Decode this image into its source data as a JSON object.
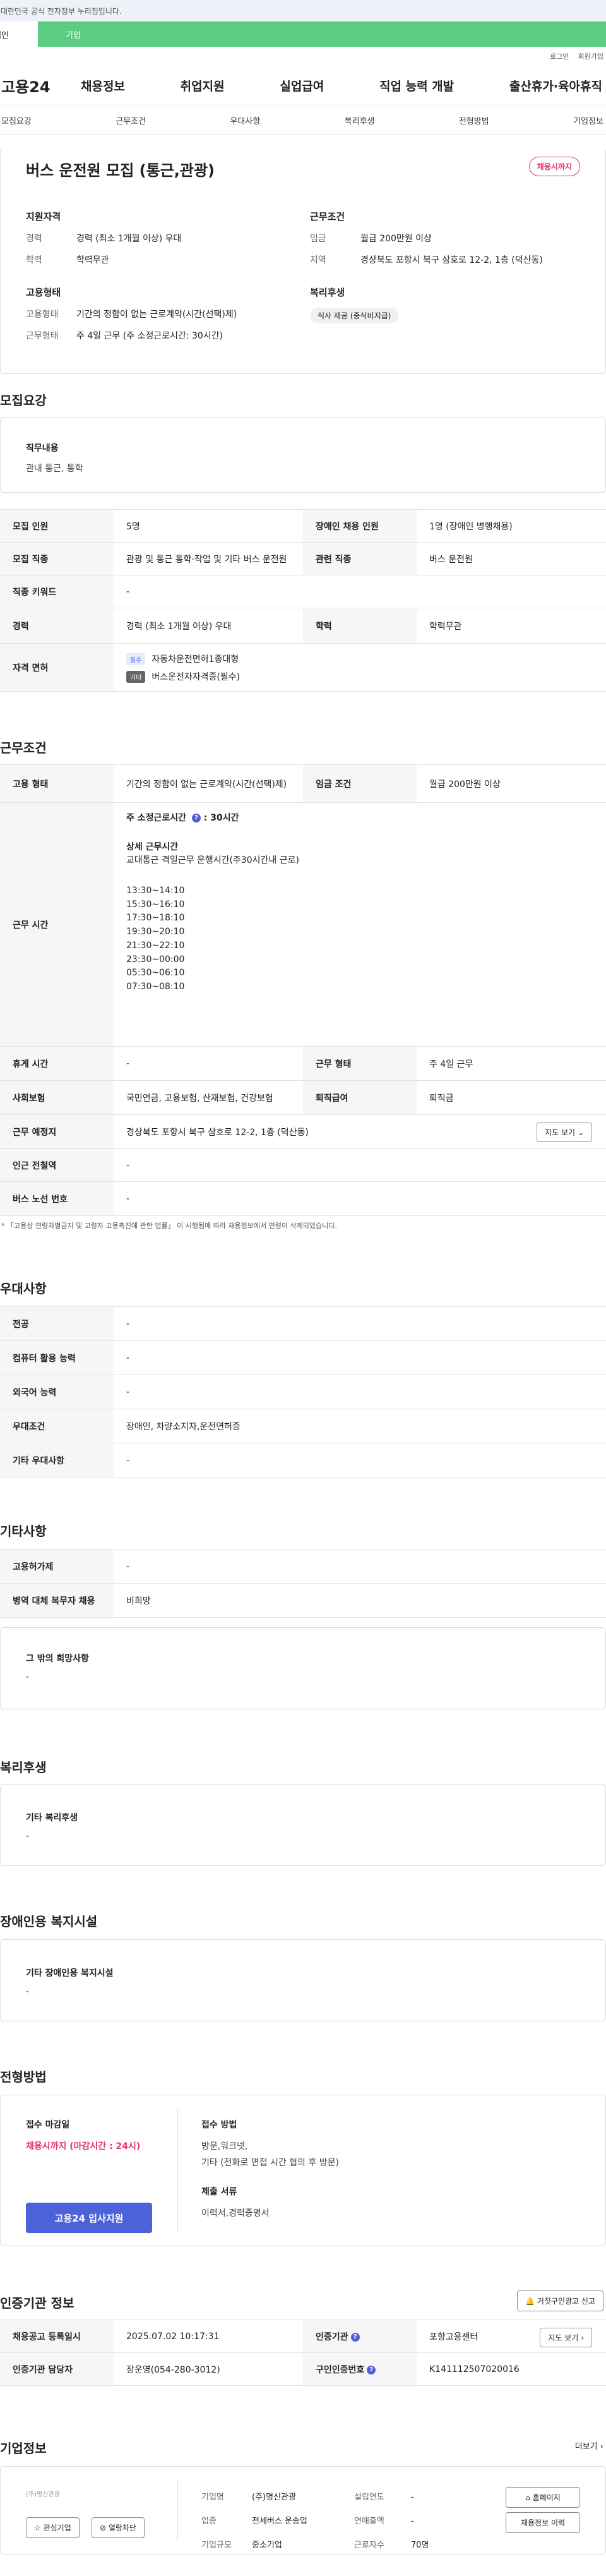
{
  "gov_banner": {
    "text": "이 누리집은 대한민국 공식 전자정부 누리집입니다."
  },
  "user_tabs": {
    "personal": "개인",
    "corp": "기업"
  },
  "util_links": [
    "로그인",
    "회원가입"
  ],
  "gnb": {
    "logo": "고용24",
    "menu": [
      "채용정보",
      "취업지원",
      "실업급여",
      "직업 능력 개발",
      "출산휴가·육아휴직"
    ]
  },
  "subnav": [
    "모집요강",
    "근무조건",
    "우대사항",
    "복리후생",
    "전형방법",
    "기업정보"
  ],
  "summary": {
    "title": "버스 운전원 모집 (통근,관광)",
    "status_badge": "채용시까지",
    "qual": {
      "heading": "지원자격",
      "exp_k": "경력",
      "exp_v": "경력 (최소 1개월 이상) 우대",
      "edu_k": "학력",
      "edu_v": "학력무관"
    },
    "cond": {
      "heading": "근무조건",
      "pay_k": "임금",
      "pay_v": "월급 200만원 이상",
      "loc_k": "지역",
      "loc_v": "경상북도 포항시 북구 삼호로 12-2, 1층 (덕산동)"
    },
    "emp": {
      "heading": "고용형태",
      "type_k": "고용형태",
      "type_v": "기간의 정함이 없는 근로계약(시간(선택)제)",
      "days_k": "근무형태",
      "days_v": "주 4일 근무 (주 소정근로시간: 30시간)"
    },
    "welfare": {
      "heading": "복리후생",
      "chip": "식사 제공 (중식비지급)"
    }
  },
  "recruit": {
    "title": "모집요강",
    "duty_label": "직무내용",
    "duty_value": "관내 통근, 통학",
    "rows": {
      "cnt_k": "모집 인원",
      "cnt_v": "5명",
      "dis_k": "장애인 채용 인원",
      "dis_v": "1명 (장애인 병행채용)",
      "job_k": "모집 직종",
      "job_v": "관광 및 통근 통학·작업 및 기타 버스 운전원",
      "rel_k": "관련 직종",
      "rel_v": "버스 운전원",
      "kw_k": "직종 키워드",
      "kw_v": "-",
      "exp_k": "경력",
      "exp_v": "경력 (최소 1개월 이상) 우대",
      "edu_k": "학력",
      "edu_v": "학력무관",
      "lic_k": "자격 면허",
      "lic1_tag": "필수",
      "lic1": "자동차운전면허1종대형",
      "lic2_tag": "기타",
      "lic2": "버스운전자자격증(필수)"
    }
  },
  "work": {
    "title": "근무조건",
    "emp_k": "고용 형태",
    "emp_v": "기간의 정함이 없는 근로계약(시간(선택)제)",
    "wage_k": "임금 조건",
    "wage_v": "월급 200만원 이상",
    "time_k": "근무 시간",
    "weekly_label": "주 소정근로시간",
    "weekly_value": ": 30시간",
    "detail_head": "상세 근무시간",
    "detail_desc": "교대통근 격일근무 운행시간(주30시간내 근로)",
    "slots": [
      "13:30~14:10",
      "15:30~16:10",
      "17:30~18:10",
      "19:30~20:10",
      "21:30~22:10",
      "23:30~00:00",
      "05:30~06:10",
      "07:30~08:10"
    ],
    "rest_k": "휴게 시간",
    "rest_v": "-",
    "form_k": "근무 형태",
    "form_v": "주 4일 근무",
    "ins_k": "사회보험",
    "ins_v": "국민연금, 고용보험, 산재보험, 건강보험",
    "ret_k": "퇴직급여",
    "ret_v": "퇴직금",
    "loc_k": "근무 예정지",
    "loc_v": "경상북도 포항시 북구 삼호로 12-2, 1층 (덕산동)",
    "map_btn": "지도 보기",
    "sub_k": "인근 전철역",
    "sub_v": "-",
    "bus_k": "버스 노선 번호",
    "bus_v": "-",
    "note": "* 「고용상 연령차별금지 및 고령자 고용촉진에 관한 법률」 이 시행됨에 따라 채용정보에서 연령이 삭제되었습니다."
  },
  "pref": {
    "title": "우대사항",
    "major_k": "전공",
    "major_v": "-",
    "pc_k": "컴퓨터 활용 능력",
    "pc_v": "-",
    "lang_k": "외국어 능력",
    "lang_v": "-",
    "cond_k": "우대조건",
    "cond_v": "장애인, 차량소지자,운전면허증",
    "etc_k": "기타 우대사항",
    "etc_v": "-"
  },
  "other": {
    "title": "기타사항",
    "perm_k": "고용허가제",
    "perm_v": "-",
    "mil_k": "병역 대체 복무자 채용",
    "mil_v": "비희망",
    "wish_label": "그 밖의 희망사항",
    "wish_value": "-"
  },
  "welfare": {
    "title": "복리후생",
    "label": "기타 복리후생",
    "value": "-"
  },
  "disability": {
    "title": "장애인용 복지시설",
    "label": "기타 장애인용 복지시설",
    "value": "-"
  },
  "process": {
    "title": "전형방법",
    "deadline_label": "접수 마감일",
    "deadline_value": "채용시까지 (마감시간 : 24시)",
    "apply_btn": "고용24 입사지원",
    "method_label": "접수 방법",
    "method_v1": "방문,워크넷,",
    "method_v2": "기타 (전화로 면접 시간 협의 후 방문)",
    "docs_label": "제출 서류",
    "docs_value": "이력서,경력증명서"
  },
  "agency": {
    "title": "인증기관 정보",
    "report_btn": "거짓구인광고 신고",
    "date_k": "채용공고 등록일시",
    "date_v": "2025.07.02 10:17:31",
    "org_k": "인증기관",
    "org_v": "포항고용센터",
    "map_btn": "지도 보기",
    "mgr_k": "인증기관 담당자",
    "mgr_v": "장운영(054-280-3012)",
    "id_k": "구인인증번호",
    "id_v": "K141112507020016"
  },
  "company": {
    "title": "기업정보",
    "more": "더보기",
    "logo_text": "(주)명신관광",
    "fav_btn": "관심기업",
    "block_btn": "열람차단",
    "name_k": "기업명",
    "name_v": "(주)명신관광",
    "ind_k": "업종",
    "ind_v": "전세버스 운송업",
    "size_k": "기업규모",
    "size_v": "중소기업",
    "year_k": "설립연도",
    "year_v": "-",
    "sales_k": "연매출액",
    "sales_v": "-",
    "emp_k": "근로자수",
    "emp_v": "70명",
    "home_btn": "홈페이지",
    "jobs_btn": "채용정보 이력"
  }
}
